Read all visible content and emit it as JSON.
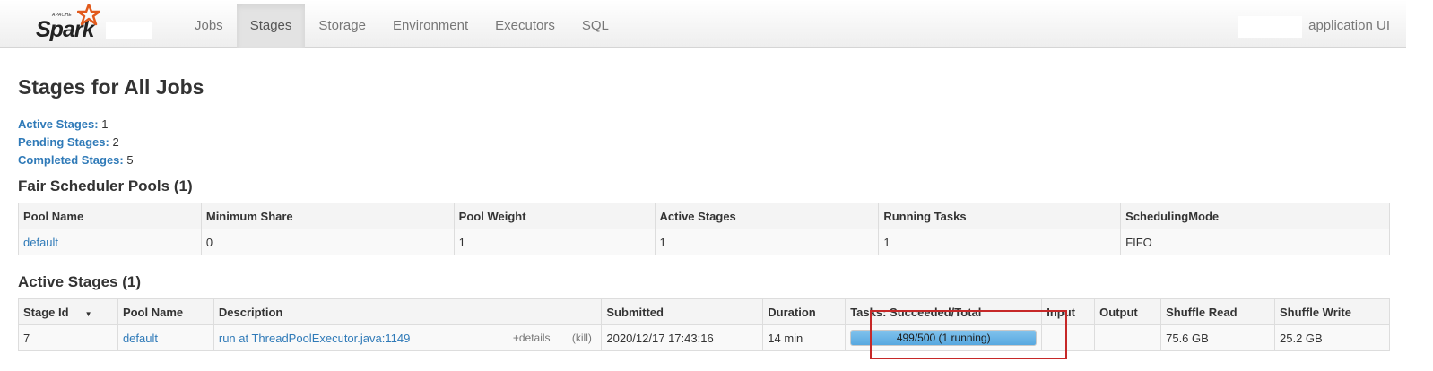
{
  "navbar": {
    "logo_apache": "APACHE",
    "logo_spark": "Spark",
    "tabs": [
      {
        "label": "Jobs"
      },
      {
        "label": "Stages"
      },
      {
        "label": "Storage"
      },
      {
        "label": "Environment"
      },
      {
        "label": "Executors"
      },
      {
        "label": "SQL"
      }
    ],
    "active_tab": "Stages",
    "app_title": "application UI"
  },
  "page": {
    "title": "Stages for All Jobs"
  },
  "summary": {
    "active_label": "Active Stages:",
    "active_value": "1",
    "pending_label": "Pending Stages:",
    "pending_value": "2",
    "completed_label": "Completed Stages:",
    "completed_value": "5"
  },
  "pools": {
    "heading": "Fair Scheduler Pools (1)",
    "headers": [
      "Pool Name",
      "Minimum Share",
      "Pool Weight",
      "Active Stages",
      "Running Tasks",
      "SchedulingMode"
    ],
    "rows": [
      [
        "default",
        "0",
        "1",
        "1",
        "1",
        "FIFO"
      ]
    ]
  },
  "active_stages": {
    "heading": "Active Stages (1)",
    "headers": [
      "Stage Id",
      "Pool Name",
      "Description",
      "Submitted",
      "Duration",
      "Tasks: Succeeded/Total",
      "Input",
      "Output",
      "Shuffle Read",
      "Shuffle Write"
    ],
    "sort_indicator": "▼",
    "rows": [
      {
        "stage_id": "7",
        "pool_name": "default",
        "description": "run at ThreadPoolExecutor.java:1149",
        "details_label": "+details",
        "kill_label": "(kill)",
        "submitted": "2020/12/17 17:43:16",
        "duration": "14 min",
        "tasks_label": "499/500 (1 running)",
        "tasks_succeeded": 499,
        "tasks_running": 1,
        "tasks_total": 500,
        "input": "",
        "output": "",
        "shuffle_read": "75.6 GB",
        "shuffle_write": "25.2 GB"
      }
    ]
  },
  "colors": {
    "link": "#2f7ab8",
    "progress_fill": "#57a8e0",
    "highlight": "#c62828"
  }
}
